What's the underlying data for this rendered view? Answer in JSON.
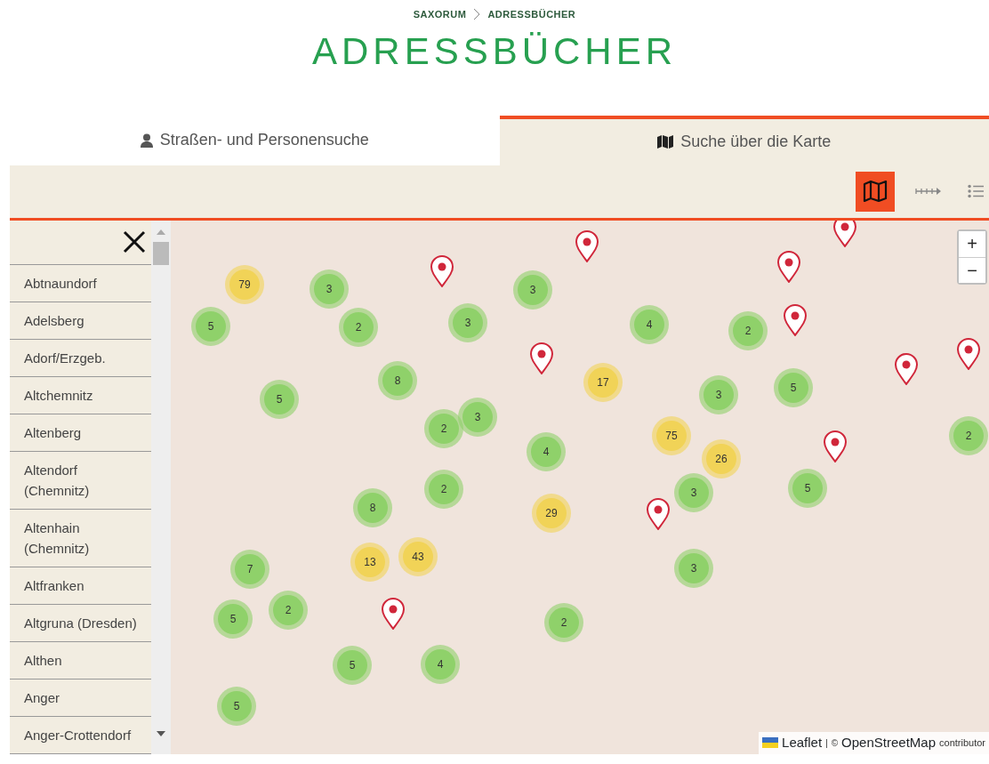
{
  "breadcrumb": [
    "SAXORUM",
    "ADRESSBÜCHER"
  ],
  "title": "ADRESSBÜCHER",
  "tabs": [
    {
      "label": "Straßen- und Personensuche",
      "selected": false
    },
    {
      "label": "Suche über die Karte",
      "selected": true
    }
  ],
  "view_buttons": [
    {
      "kind": "map",
      "selected": true
    },
    {
      "kind": "timeline",
      "selected": false
    },
    {
      "kind": "list",
      "selected": false
    }
  ],
  "places": [
    "Abtnaundorf",
    "Adelsberg",
    "Adorf/Erzgeb.",
    "Altchemnitz",
    "Altenberg",
    "Altendorf (Chemnitz)",
    "Altenhain (Chemnitz)",
    "Altfranken",
    "Altgruna (Dresden)",
    "Althen",
    "Anger",
    "Anger-Crottendorf"
  ],
  "map": {
    "zoom_buttons": [
      "+",
      "−"
    ],
    "clusters": [
      {
        "count": "79",
        "color": "#f1d357"
      },
      {
        "count": "3",
        "color": "#8fd16a"
      },
      {
        "count": "3",
        "color": "#8fd16a"
      },
      {
        "count": "3",
        "color": "#8fd16a"
      },
      {
        "count": "4",
        "color": "#8fd16a"
      },
      {
        "count": "2",
        "color": "#8fd16a"
      },
      {
        "count": "5",
        "color": "#8fd16a"
      },
      {
        "count": "2",
        "color": "#8fd16a"
      },
      {
        "count": "8",
        "color": "#8fd16a"
      },
      {
        "count": "17",
        "color": "#f1d357"
      },
      {
        "count": "3",
        "color": "#8fd16a"
      },
      {
        "count": "5",
        "color": "#8fd16a"
      },
      {
        "count": "5",
        "color": "#8fd16a"
      },
      {
        "count": "2",
        "color": "#8fd16a"
      },
      {
        "count": "3",
        "color": "#8fd16a"
      },
      {
        "count": "4",
        "color": "#8fd16a"
      },
      {
        "count": "75",
        "color": "#f1d357"
      },
      {
        "count": "26",
        "color": "#f1d357"
      },
      {
        "count": "2",
        "color": "#8fd16a"
      },
      {
        "count": "2",
        "color": "#8fd16a"
      },
      {
        "count": "8",
        "color": "#8fd16a"
      },
      {
        "count": "3",
        "color": "#8fd16a"
      },
      {
        "count": "5",
        "color": "#8fd16a"
      },
      {
        "count": "29",
        "color": "#f1d357"
      },
      {
        "count": "7",
        "color": "#8fd16a"
      },
      {
        "count": "13",
        "color": "#f1d357"
      },
      {
        "count": "43",
        "color": "#f1d357"
      },
      {
        "count": "3",
        "color": "#8fd16a"
      },
      {
        "count": "5",
        "color": "#8fd16a"
      },
      {
        "count": "2",
        "color": "#8fd16a"
      },
      {
        "count": "2",
        "color": "#8fd16a"
      },
      {
        "count": "5",
        "color": "#8fd16a"
      },
      {
        "count": "4",
        "color": "#8fd16a"
      },
      {
        "count": "5",
        "color": "#8fd16a"
      }
    ],
    "pins": [
      {
        "kind": "location"
      },
      {
        "kind": "location"
      },
      {
        "kind": "location"
      },
      {
        "kind": "location"
      },
      {
        "kind": "location"
      },
      {
        "kind": "location"
      },
      {
        "kind": "location"
      },
      {
        "kind": "location"
      },
      {
        "kind": "location"
      },
      {
        "kind": "location"
      },
      {
        "kind": "location"
      }
    ],
    "attribution": {
      "library": "Leaflet",
      "separator": "|",
      "copyright": "©",
      "source": "OpenStreetMap",
      "suffix": "contributor"
    }
  }
}
